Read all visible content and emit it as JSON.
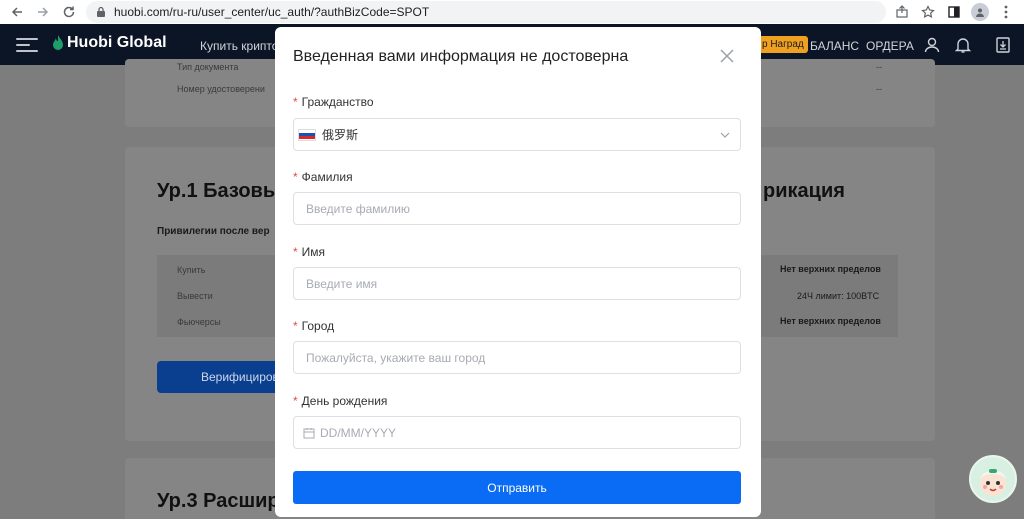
{
  "browser": {
    "url": "huobi.com/ru-ru/user_center/uc_auth/?authBizCode=SPOT"
  },
  "header": {
    "logo_text": "Huobi Global",
    "nav_buy": "Купить крипто",
    "reward_badge": "р Наград",
    "nav_balance": "БАЛАНС",
    "nav_orders": "ОРДЕРА"
  },
  "background": {
    "doc_type_label": "Тип документа",
    "doc_type_value": "--",
    "id_number_label": "Номер удостоверени",
    "id_number_value": "--",
    "level1_title": "Ур.1 Базовые",
    "level1_title_right": "рикация",
    "privileges_label": "Привилегии после вер",
    "rows": [
      {
        "label": "Купить",
        "value": "Нет верхних пределов"
      },
      {
        "label": "Вывести",
        "value": "24Ч лимит: 100BTC"
      },
      {
        "label": "Фьючерсы",
        "value": "Нет верхних пределов"
      }
    ],
    "verify_button": "Верифициров",
    "level3_title": "Ур.3 Расшире"
  },
  "modal": {
    "title": "Введенная вами информация не достоверна",
    "required_mark": "*",
    "citizenship": {
      "label": "Гражданство",
      "value": "俄罗斯"
    },
    "surname": {
      "label": "Фамилия",
      "placeholder": "Введите фамилию"
    },
    "name": {
      "label": "Имя",
      "placeholder": "Введите имя"
    },
    "city": {
      "label": "Город",
      "placeholder": "Пожалуйста, укажите ваш город"
    },
    "birthday": {
      "label": "День рождения",
      "placeholder": "DD/MM/YYYY"
    },
    "submit_label": "Отправить"
  },
  "colors": {
    "primary": "#0a6cf5",
    "required": "#e5484d",
    "header_bg": "#0b1526",
    "overlay": "#7d7d7d"
  },
  "icons": [
    "back-icon",
    "forward-icon",
    "reload-icon",
    "lock-icon",
    "share-icon",
    "star-icon",
    "sidepanel-icon",
    "profile-icon",
    "kebab-icon",
    "menu-icon",
    "user-icon",
    "bell-icon",
    "download-icon",
    "close-icon",
    "chevron-down-icon",
    "calendar-icon",
    "russia-flag-icon",
    "mascot-icon"
  ]
}
